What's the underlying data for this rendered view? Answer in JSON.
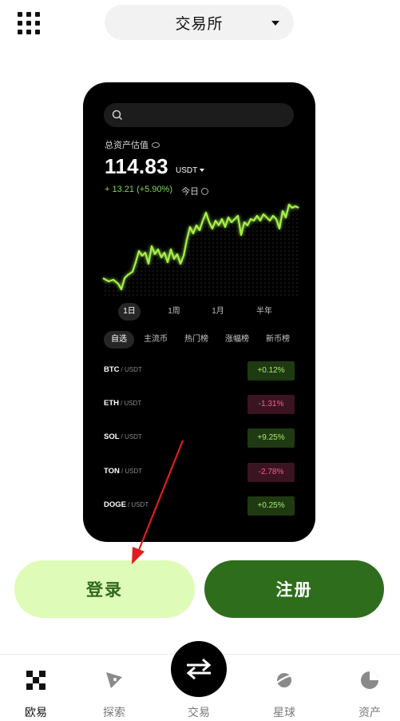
{
  "header": {
    "mode_label": "交易所"
  },
  "preview": {
    "asset_label": "总资产估值",
    "balance": "114.83",
    "unit": "USDT",
    "change": "+ 13.21 (+5.90%)",
    "period": "今日",
    "ranges": [
      "1日",
      "1周",
      "1月",
      "半年"
    ],
    "active_range": "1日",
    "tabs": [
      "自选",
      "主流币",
      "热门榜",
      "涨幅榜",
      "新币榜"
    ],
    "active_tab": "自选",
    "rows": [
      {
        "base": "BTC",
        "quote": "/ USDT",
        "change": "+0.12%",
        "direction": "up"
      },
      {
        "base": "ETH",
        "quote": "/ USDT",
        "change": "-1.31%",
        "direction": "down"
      },
      {
        "base": "SOL",
        "quote": "/ USDT",
        "change": "+9.25%",
        "direction": "up"
      },
      {
        "base": "TON",
        "quote": "/ USDT",
        "change": "-2.78%",
        "direction": "down"
      },
      {
        "base": "DOGE",
        "quote": "/ USDT",
        "change": "+0.25%",
        "direction": "up"
      }
    ],
    "colors": {
      "up_text": "#a6e86a",
      "down_text": "#ff5a8a",
      "chart_line": "#a6f04a"
    }
  },
  "buttons": {
    "login": "登录",
    "register": "注册"
  },
  "tabbar": {
    "items": [
      {
        "label": "欧易",
        "icon": "okx-logo-icon",
        "active": true
      },
      {
        "label": "探索",
        "icon": "compass-icon",
        "active": false
      },
      {
        "label": "交易",
        "icon": "swap-arrows-icon",
        "active": false
      },
      {
        "label": "星球",
        "icon": "planet-icon",
        "active": false
      },
      {
        "label": "资产",
        "icon": "pie-chart-icon",
        "active": false
      }
    ]
  }
}
